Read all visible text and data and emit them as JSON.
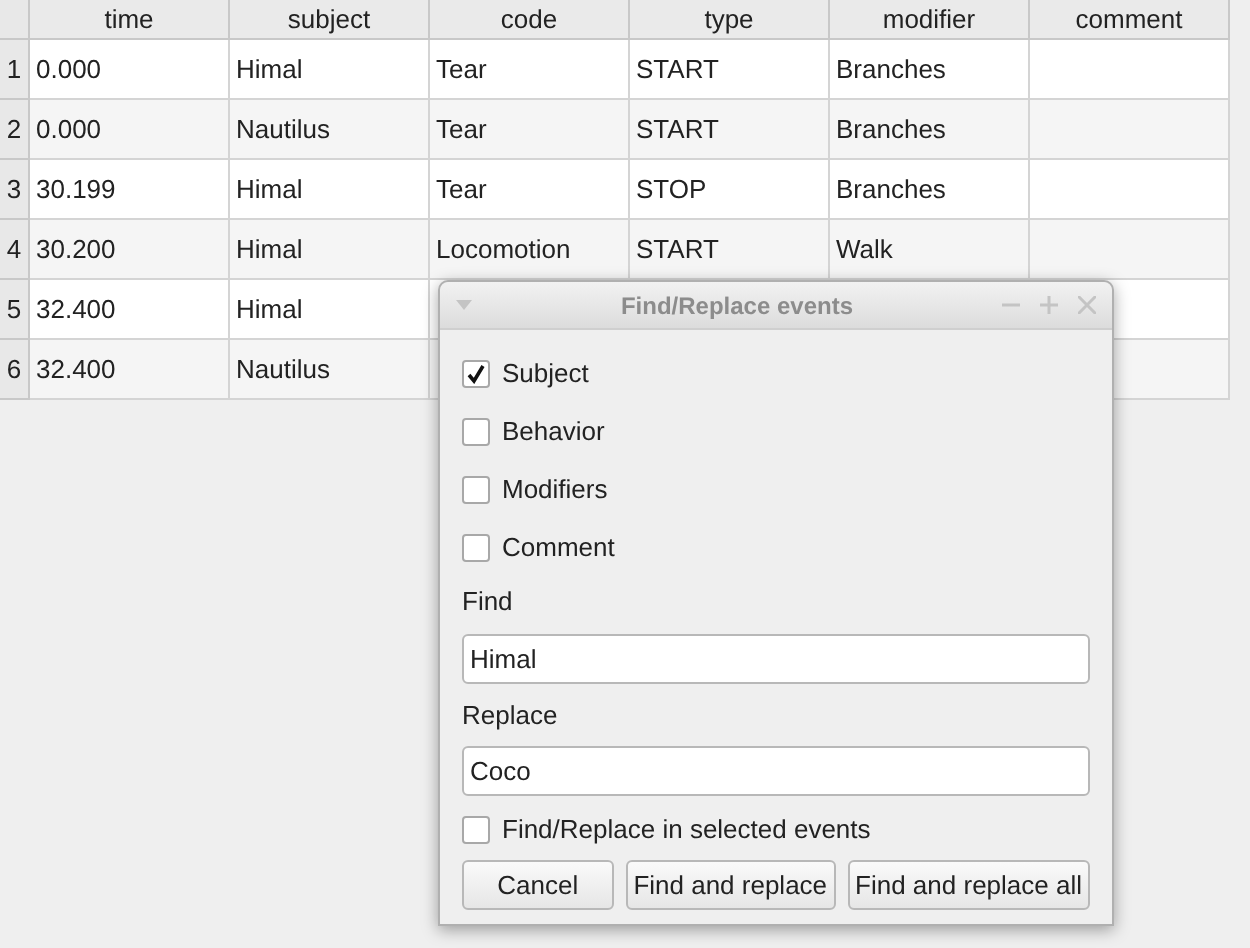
{
  "table": {
    "columns": [
      "time",
      "subject",
      "code",
      "type",
      "modifier",
      "comment"
    ],
    "rows": [
      {
        "number": "1",
        "cells": [
          "0.000",
          "Himal",
          "Tear",
          "START",
          "Branches"
        ]
      },
      {
        "number": "2",
        "cells": [
          "0.000",
          "Nautilus",
          "Tear",
          "START",
          "Branches"
        ]
      },
      {
        "number": "3",
        "cells": [
          "30.199",
          "Himal",
          "Tear",
          "STOP",
          "Branches"
        ]
      },
      {
        "number": "4",
        "cells": [
          "30.200",
          "Himal",
          "Locomotion",
          "START",
          "Walk"
        ]
      },
      {
        "number": "5",
        "cells": [
          "32.400",
          "Himal"
        ]
      },
      {
        "number": "6",
        "cells": [
          "32.400",
          "Nautilus"
        ]
      }
    ]
  },
  "dialog": {
    "title": "Find/Replace events",
    "options": [
      {
        "label": "Subject",
        "checked": true
      },
      {
        "label": "Behavior",
        "checked": false
      },
      {
        "label": "Modifiers",
        "checked": false
      },
      {
        "label": "Comment",
        "checked": false
      }
    ],
    "find": {
      "label": "Find",
      "value": "Himal"
    },
    "replace": {
      "label": "Replace",
      "value": "Coco"
    },
    "selected_only": {
      "label": "Find/Replace in selected events",
      "checked": false
    },
    "buttons": [
      "Cancel",
      "Find and replace",
      "Find and replace all"
    ]
  }
}
